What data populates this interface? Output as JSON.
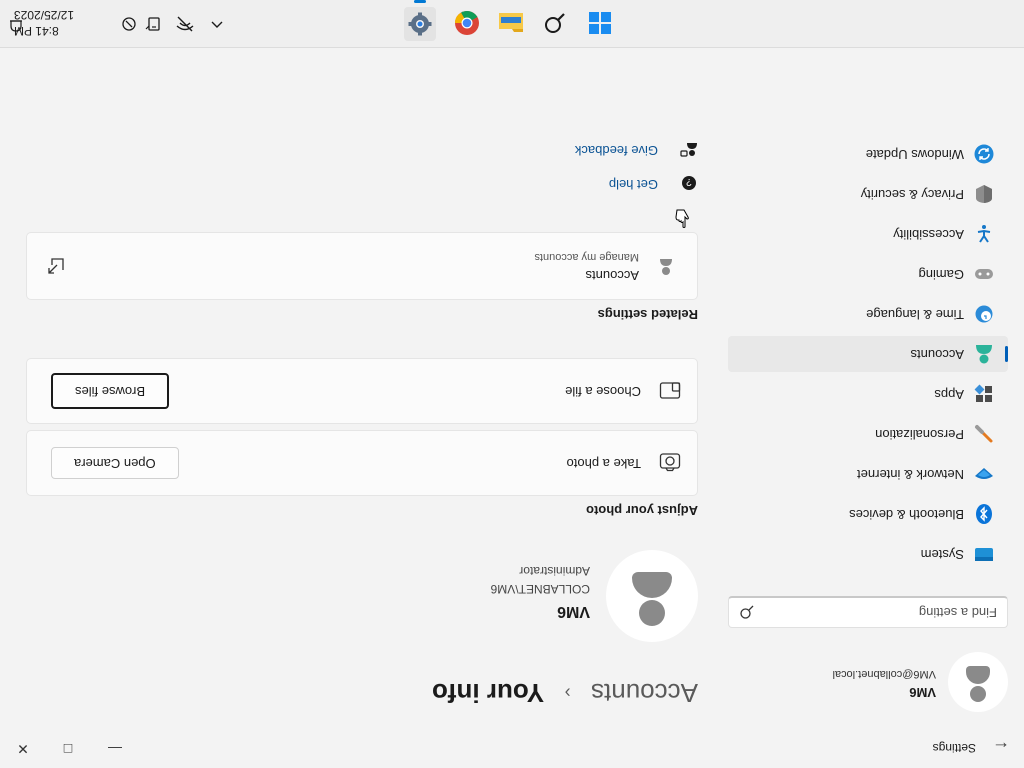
{
  "titlebar": {
    "app_title": "Settings",
    "back_icon": "back-arrow-icon",
    "minimize_icon": "minimize-icon",
    "maximize_icon": "maximize-icon",
    "close_icon": "close-icon"
  },
  "user": {
    "name": "VM6",
    "email": "VM6@collabnet.local"
  },
  "search": {
    "placeholder": "Find a setting",
    "value": ""
  },
  "sidebar": {
    "items": [
      {
        "label": "System",
        "icon": "monitor-icon",
        "active": false
      },
      {
        "label": "Bluetooth & devices",
        "icon": "bluetooth-icon",
        "active": false
      },
      {
        "label": "Network & internet",
        "icon": "network-icon",
        "active": false
      },
      {
        "label": "Personalization",
        "icon": "brush-icon",
        "active": false
      },
      {
        "label": "Apps",
        "icon": "apps-icon",
        "active": false
      },
      {
        "label": "Accounts",
        "icon": "accounts-icon",
        "active": true
      },
      {
        "label": "Time & language",
        "icon": "globe-clock-icon",
        "active": false
      },
      {
        "label": "Gaming",
        "icon": "gamepad-icon",
        "active": false
      },
      {
        "label": "Accessibility",
        "icon": "accessibility-icon",
        "active": false
      },
      {
        "label": "Privacy & security",
        "icon": "shield-icon",
        "active": false
      },
      {
        "label": "Windows Update",
        "icon": "update-icon",
        "active": false
      }
    ]
  },
  "main": {
    "breadcrumb_parent": "Accounts",
    "breadcrumb_separator": "›",
    "page_title": "Your info",
    "profile": {
      "name": "VM6",
      "domain": "COLLABNET\\VM6",
      "role": "Administrator"
    },
    "adjust_photo": {
      "title": "Adjust your photo",
      "take_photo_label": "Take a photo",
      "open_camera_button": "Open Camera",
      "choose_file_label": "Choose a file",
      "browse_files_button": "Browse files"
    },
    "related": {
      "title": "Related settings",
      "accounts_title": "Accounts",
      "accounts_subtitle": "Manage my accounts"
    },
    "help": {
      "get_help": "Get help",
      "give_feedback": "Give feedback"
    }
  },
  "taskbar": {
    "pinned": [
      "windows-start-icon",
      "search-icon",
      "file-explorer-icon",
      "chrome-icon",
      "settings-icon"
    ],
    "active_app": "settings-icon",
    "time": "8:41 PM",
    "date": "12/25/2023"
  },
  "colors": {
    "accent": "#005fb8",
    "link": "#0b5394",
    "background": "#f3f3f3",
    "card": "#fbfbfb"
  }
}
